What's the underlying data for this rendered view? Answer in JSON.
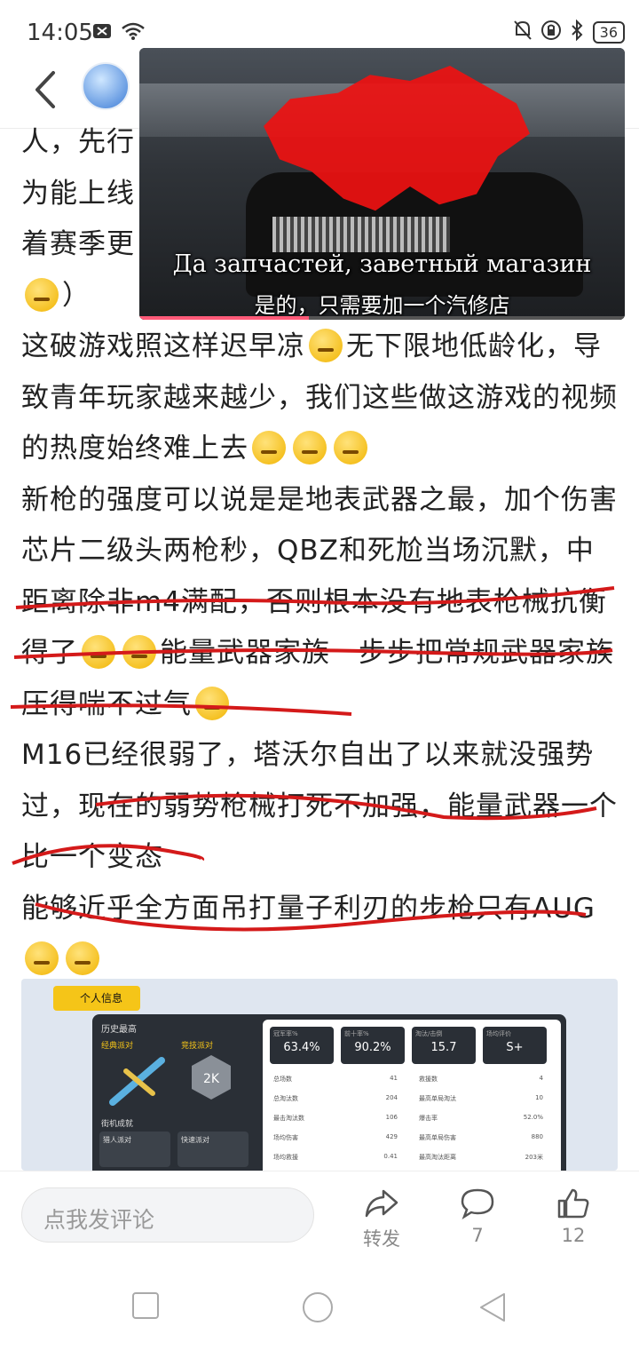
{
  "status_bar": {
    "time": "14:05",
    "battery": "36"
  },
  "video": {
    "subtitle_ru": "Да запчастей, заветный магазин",
    "subtitle_cn": "是的，只需要加一个汽修店",
    "progress_percent": 35
  },
  "post": {
    "paragraphs": [
      {
        "segments": [
          "人，先行"
        ]
      },
      {
        "segments": [
          "为能上线"
        ]
      },
      {
        "segments": [
          "着赛季更"
        ]
      },
      {
        "segments": [
          "",
          "）"
        ],
        "emoji_after": [
          0
        ]
      },
      {
        "segments": [
          "这破游戏照这样迟早凉",
          "无下限地低龄化，导致青年玩家越来越少，我们这些做这游戏的视频的热度始终难上去"
        ],
        "emoji_after": [
          0
        ]
      },
      {
        "segments": [
          "新枪的强度可以说是是地表武器之最，加个伤害芯片二级头两枪秒，QBZ和死尬当场沉默，中距离除非m4满配，否则根本没有地表枪械抗衡得了",
          "",
          "能量武器家族一步步把常规武器家族压得喘不过气"
        ],
        "emoji_after": [
          0,
          1
        ]
      },
      {
        "segments": [
          "M16已经很弱了，塔沃尔自出了以来就没强势过，现在的弱势枪械打死不加强，能量武器一个比一个变态"
        ]
      },
      {
        "segments": [
          "能够近乎全方面吊打量子利刃的步枪只有AUG"
        ]
      }
    ]
  },
  "preview_image": {
    "tab_label": "个人信息",
    "history_title": "历史最高",
    "mode_classic": "经典派对",
    "mode_competitive": "竞技派对",
    "arcade_title": "街机成就",
    "card_1": "猎人派对",
    "card_2": "快速派对",
    "stats": [
      {
        "label": "冠军率%",
        "value": "63.4%"
      },
      {
        "label": "前十率%",
        "value": "90.2%"
      },
      {
        "label": "淘汰/击倒",
        "value": "15.7"
      },
      {
        "label": "场均评价",
        "value": "S+"
      }
    ],
    "rows_left": [
      {
        "label": "总场数",
        "value": "41"
      },
      {
        "label": "总淘汰数",
        "value": "204"
      },
      {
        "label": "最击淘汰数",
        "value": "106"
      },
      {
        "label": "场均伤害",
        "value": "429"
      },
      {
        "label": "场均救援",
        "value": "0.41"
      }
    ],
    "rows_right": [
      {
        "label": "救援数",
        "value": "4"
      },
      {
        "label": "最高单局淘汰",
        "value": "10"
      },
      {
        "label": "爆击率",
        "value": "52.0%"
      },
      {
        "label": "最高单局伤害",
        "value": "880"
      },
      {
        "label": "最高淘汰距离",
        "value": "203米"
      }
    ]
  },
  "bottom_bar": {
    "comment_placeholder": "点我发评论",
    "share_label": "转发",
    "comment_count": "7",
    "like_count": "12"
  }
}
